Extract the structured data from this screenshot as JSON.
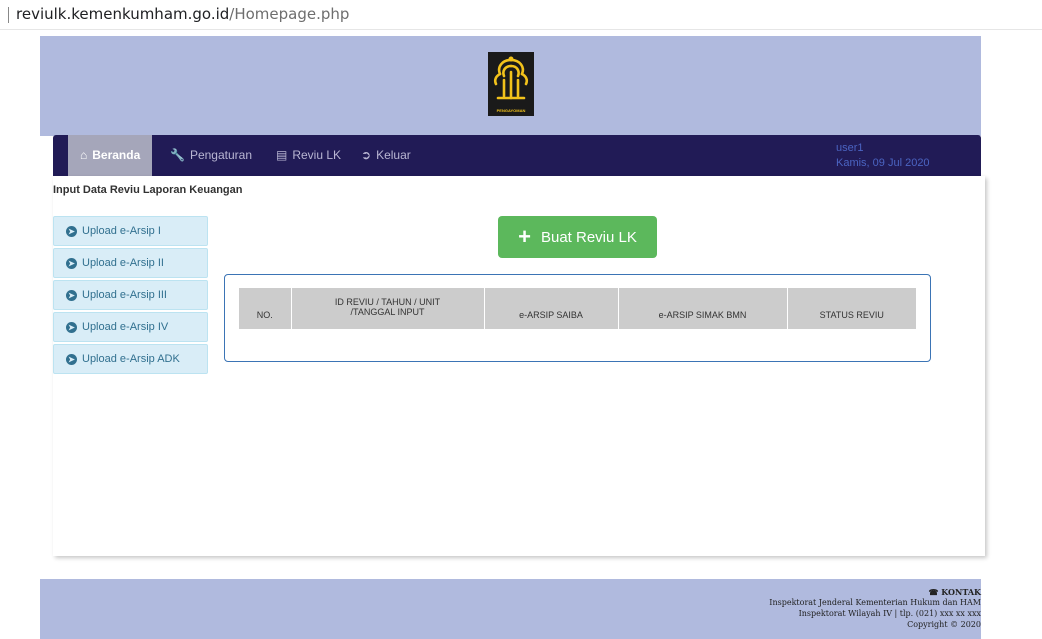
{
  "browser": {
    "url_host": "reviulk.kemenkumham.go.id",
    "url_path": "/Homepage.php"
  },
  "header": {
    "logo_text": "PENGAYOMAN"
  },
  "nav": {
    "items": [
      {
        "label": "Beranda",
        "icon": "home-icon"
      },
      {
        "label": "Pengaturan",
        "icon": "wrench-icon"
      },
      {
        "label": "Reviu LK",
        "icon": "list-icon"
      },
      {
        "label": "Keluar",
        "icon": "logout-icon"
      }
    ],
    "user": "user1",
    "date": "Kamis, 09 Jul 2020"
  },
  "main": {
    "title": "Input Data Reviu Laporan Keuangan",
    "sidebar": [
      {
        "label": "Upload e-Arsip I"
      },
      {
        "label": "Upload e-Arsip II"
      },
      {
        "label": "Upload e-Arsip III"
      },
      {
        "label": "Upload e-Arsip IV"
      },
      {
        "label": "Upload e-Arsip ADK"
      }
    ],
    "create_button": "Buat Reviu LK",
    "table": {
      "headers": [
        "NO.",
        "ID REVIU / TAHUN / UNIT",
        "/TANGGAL INPUT",
        "e-ARSIP SAIBA",
        "e-ARSIP SIMAK BMN",
        "STATUS REVIU"
      ],
      "rows": []
    }
  },
  "footer": {
    "kontak_label": "KONTAK",
    "line1": "Inspektorat Jenderal Kementerian Hukum dan HAM",
    "line2": "Inspektorat Wilayah IV | tlp. (021) xxx xx xxx",
    "line3": "Copyright © 2020"
  },
  "colors": {
    "header_bg": "#b0bade",
    "navbar_bg": "#211b56",
    "active_tab_bg": "#a5a6ba",
    "user_text": "#4b64c2",
    "side_btn_bg": "#d9edf7",
    "success_btn": "#5cb85c",
    "panel_border": "#3b74b5",
    "table_head_bg": "#cccccc"
  }
}
